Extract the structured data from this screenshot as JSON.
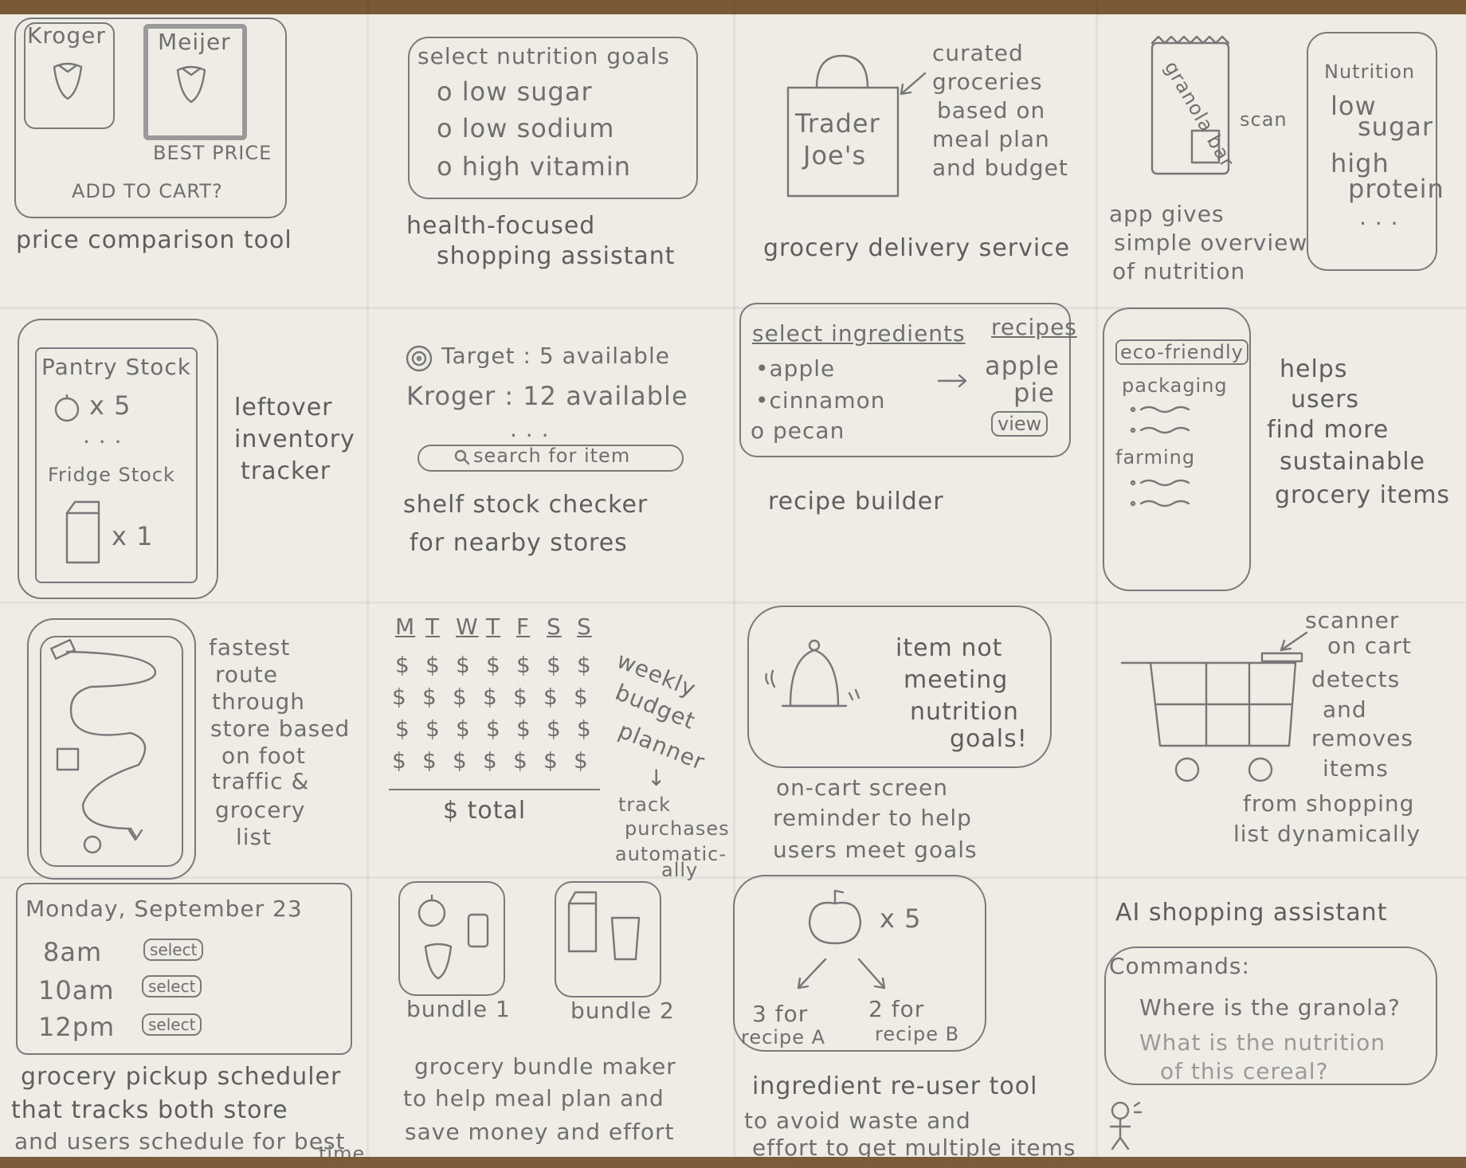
{
  "cells": {
    "price": {
      "store_a": "Kroger",
      "store_b": "Meijer",
      "badge": "BEST PRICE",
      "cta": "ADD TO CART?",
      "caption": "price comparison tool"
    },
    "health": {
      "heading": "select nutrition goals",
      "options": [
        "o low sugar",
        "o low sodium",
        "o high vitamin"
      ],
      "caption1": "health-focused",
      "caption2": "shopping assistant"
    },
    "delivery": {
      "bag_label1": "Trader",
      "bag_label2": "Joe's",
      "note": [
        "curated",
        "groceries",
        "based on",
        "meal plan",
        "and budget"
      ],
      "caption": "grocery delivery service"
    },
    "scan": {
      "bar_label": "granola bar",
      "scan_label": "scan",
      "phone_title": "Nutrition",
      "phone_lines": [
        "low",
        "sugar",
        "high",
        "protein",
        ". . ."
      ],
      "caption": [
        "app gives",
        "simple overview",
        "of nutrition"
      ]
    },
    "pantry": {
      "title1": "Pantry Stock",
      "qty1": "x 5",
      "dots": ". . .",
      "title2": "Fridge Stock",
      "qty2": "x 1",
      "caption": [
        "leftover",
        "inventory",
        "tracker"
      ]
    },
    "shelf": {
      "line1": "Target : 5 available",
      "line2": "Kroger : 12 available",
      "dots": ". . .",
      "search": "search for item",
      "caption1": "shelf stock checker",
      "caption2": "for nearby stores"
    },
    "recipe": {
      "heading": "select ingredients",
      "ingredients": [
        "•apple",
        "•cinnamon",
        "o pecan"
      ],
      "recipes_label": "recipes",
      "result1": "apple",
      "result2": "pie",
      "view": "view",
      "caption": "recipe builder"
    },
    "eco": {
      "title": "eco-friendly",
      "section1": "packaging",
      "section2": "farming",
      "caption": [
        "helps",
        "users",
        "find more",
        "sustainable",
        "grocery items"
      ]
    },
    "route": {
      "caption": [
        "fastest",
        "route",
        "through",
        "store based",
        "on foot",
        "traffic &",
        "grocery",
        "list"
      ]
    },
    "budget": {
      "days": [
        "M",
        "T",
        "W",
        "T",
        "F",
        "S",
        "S"
      ],
      "rows": [
        [
          "$",
          "$",
          "$",
          "$",
          "$",
          "$",
          "$"
        ],
        [
          "$",
          "$",
          "$",
          "$",
          "$",
          "$",
          "$"
        ],
        [
          "$",
          "$",
          "$",
          "$",
          "$",
          "$",
          "$"
        ],
        [
          "$",
          "$",
          "$",
          "$",
          "$",
          "$",
          "$"
        ]
      ],
      "total": "$ total",
      "side": [
        "weekly",
        "budget",
        "planner"
      ],
      "arrow": "↓",
      "track": [
        "track",
        "purchases",
        "automatic-",
        "ally"
      ]
    },
    "reminder": {
      "message": [
        "item not",
        "meeting",
        "nutrition",
        "goals!"
      ],
      "caption": [
        "on-cart screen",
        "reminder to help",
        "users meet goals"
      ]
    },
    "cart": {
      "label": [
        "scanner",
        "on cart"
      ],
      "caption": [
        "detects",
        "and",
        "removes",
        "items",
        "from shopping",
        "list dynamically"
      ]
    },
    "pickup": {
      "date": "Monday, September 23",
      "slots": [
        "8am",
        "10am",
        "12pm"
      ],
      "select": "select",
      "caption": [
        "grocery pickup scheduler",
        "that tracks both store",
        "and users schedule for best",
        "time"
      ]
    },
    "bundle": {
      "label1": "bundle 1",
      "label2": "bundle 2",
      "caption": [
        "grocery bundle maker",
        "to help meal plan and",
        "save money and effort"
      ]
    },
    "reuse": {
      "qty": "x 5",
      "split1": [
        "3 for",
        "recipe A"
      ],
      "split2": [
        "2 for",
        "recipe B"
      ],
      "caption": [
        "ingredient re-user tool",
        "to avoid waste and",
        "effort to get multiple items"
      ]
    },
    "ai": {
      "title": "AI shopping assistant",
      "commands": "Commands:",
      "q1": "Where is the granola?",
      "q2": "What is the nutrition",
      "q3": "of this cereal?"
    }
  }
}
